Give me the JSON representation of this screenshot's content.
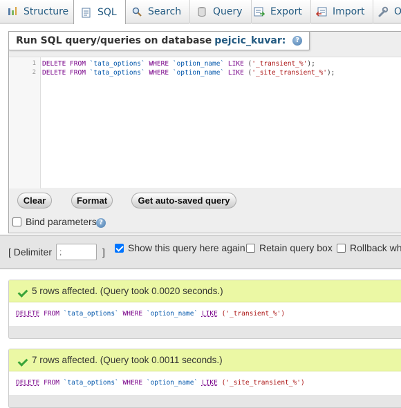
{
  "tabs": [
    {
      "label": "Structure",
      "icon": "structure-icon",
      "active": false
    },
    {
      "label": "SQL",
      "icon": "sql-icon",
      "active": true
    },
    {
      "label": "Search",
      "icon": "search-icon",
      "active": false
    },
    {
      "label": "Query",
      "icon": "query-icon",
      "active": false
    },
    {
      "label": "Export",
      "icon": "export-icon",
      "active": false
    },
    {
      "label": "Import",
      "icon": "import-icon",
      "active": false
    },
    {
      "label": "O",
      "icon": "wrench-icon",
      "active": false
    }
  ],
  "fieldset": {
    "legend_prefix": "Run SQL query/queries on database",
    "database": "pejcic_kuvar:"
  },
  "editor": {
    "line_numbers": [
      "1",
      "2"
    ],
    "lines": [
      {
        "kw1": "DELETE FROM",
        "table": "`tata_options`",
        "kw2": "WHERE",
        "col": "`option_name`",
        "kw3": "LIKE",
        "open": "(",
        "value": "'_transient_%'",
        "close": ");"
      },
      {
        "kw1": "DELETE FROM",
        "table": "`tata_options`",
        "kw2": "WHERE",
        "col": "`option_name`",
        "kw3": "LIKE",
        "open": "(",
        "value": "'_site_transient_%'",
        "close": ");"
      }
    ]
  },
  "buttons": {
    "clear": "Clear",
    "format": "Format",
    "autosaved": "Get auto-saved query"
  },
  "bind_parameters": {
    "label": "Bind parameters",
    "checked": false
  },
  "options": {
    "delimiter_open": "[ Delimiter",
    "delimiter_value": ";",
    "delimiter_close": "]",
    "show_again": {
      "label": "Show this query here again",
      "checked": true
    },
    "retain": {
      "label": "Retain query box",
      "checked": false
    },
    "rollback": {
      "label": "Rollback whe",
      "checked": false
    }
  },
  "results": [
    {
      "message": "5 rows affected. (Query took 0.0020 seconds.)",
      "sql": {
        "delete": "DELETE",
        "from": "FROM",
        "table": "`tata_options`",
        "where": "WHERE",
        "col": "`option_name`",
        "like": "LIKE",
        "value": "('_transient_%')"
      }
    },
    {
      "message": "7 rows affected. (Query took 0.0011 seconds.)",
      "sql": {
        "delete": "DELETE",
        "from": "FROM",
        "table": "`tata_options`",
        "where": "WHERE",
        "col": "`option_name`",
        "like": "LIKE",
        "value": "('_site_transient_%')"
      }
    }
  ],
  "colors": {
    "success_bg": "#ebf8a4",
    "link": "#235a81",
    "keyword": "#770088",
    "identifier": "#0055aa",
    "string": "#aa1111"
  }
}
